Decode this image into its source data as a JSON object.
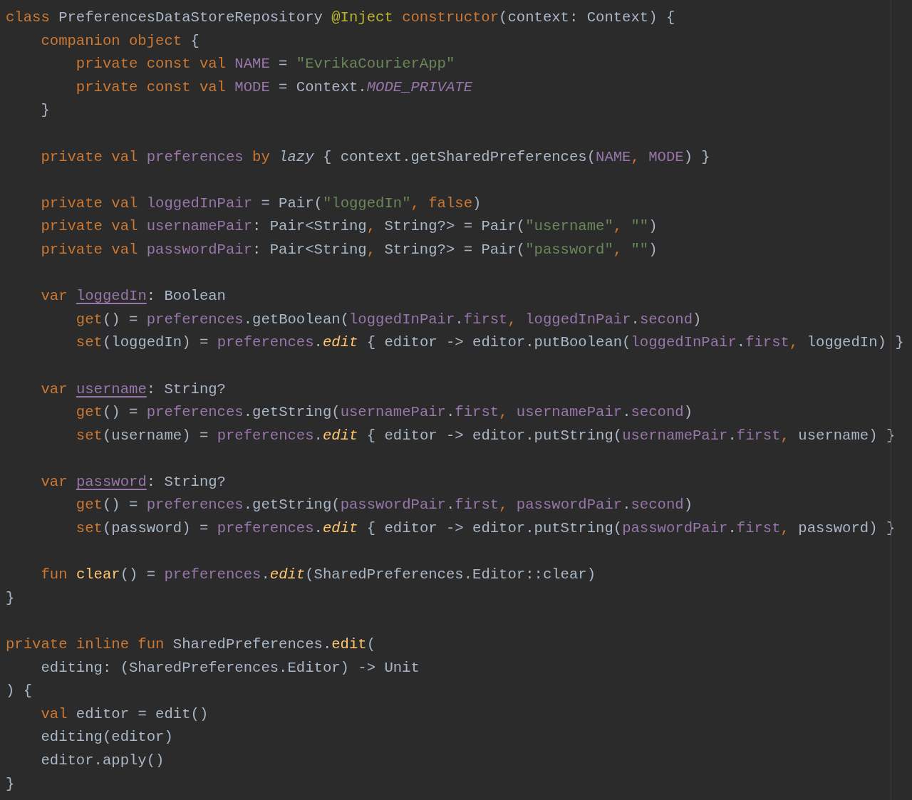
{
  "editor": {
    "lines": [
      {
        "kind": "code",
        "tokens": [
          {
            "text": "class",
            "kind": "keyword"
          },
          {
            "text": " PreferencesDataStoreRepository ",
            "kind": "plain"
          },
          {
            "text": "@Inject ",
            "kind": "annotation"
          },
          {
            "text": "constructor",
            "kind": "keyword"
          },
          {
            "text": "(context: Context) {",
            "kind": "plain"
          }
        ]
      },
      {
        "kind": "code",
        "tokens": [
          {
            "text": "    companion object",
            "kind": "keyword"
          },
          {
            "text": " {",
            "kind": "plain"
          }
        ]
      },
      {
        "kind": "code",
        "tokens": [
          {
            "text": "        private const val ",
            "kind": "keyword"
          },
          {
            "text": "NAME",
            "kind": "property"
          },
          {
            "text": " = ",
            "kind": "plain"
          },
          {
            "text": "\"EvrikaCourierApp\"",
            "kind": "string"
          }
        ]
      },
      {
        "kind": "code",
        "tokens": [
          {
            "text": "        private const val ",
            "kind": "keyword"
          },
          {
            "text": "MODE",
            "kind": "property"
          },
          {
            "text": " = Context.",
            "kind": "plain"
          },
          {
            "text": "MODE_PRIVATE",
            "kind": "property-italic"
          }
        ]
      },
      {
        "kind": "code",
        "tokens": [
          {
            "text": "    }",
            "kind": "plain"
          }
        ]
      },
      {
        "kind": "blank"
      },
      {
        "kind": "code",
        "tokens": [
          {
            "text": "    private val ",
            "kind": "keyword"
          },
          {
            "text": "preferences ",
            "kind": "property"
          },
          {
            "text": "by ",
            "kind": "keyword"
          },
          {
            "text": "lazy",
            "kind": "plain-italic"
          },
          {
            "text": " { context.getSharedPreferences(",
            "kind": "plain"
          },
          {
            "text": "NAME",
            "kind": "property"
          },
          {
            "text": ", ",
            "kind": "keyword"
          },
          {
            "text": "MODE",
            "kind": "property"
          },
          {
            "text": ") }",
            "kind": "plain"
          }
        ]
      },
      {
        "kind": "blank"
      },
      {
        "kind": "code",
        "tokens": [
          {
            "text": "    private val ",
            "kind": "keyword"
          },
          {
            "text": "loggedInPair",
            "kind": "property"
          },
          {
            "text": " = Pair(",
            "kind": "plain"
          },
          {
            "text": "\"loggedIn\"",
            "kind": "string"
          },
          {
            "text": ", ",
            "kind": "keyword"
          },
          {
            "text": "false",
            "kind": "keyword"
          },
          {
            "text": ")",
            "kind": "plain"
          }
        ]
      },
      {
        "kind": "code",
        "tokens": [
          {
            "text": "    private val ",
            "kind": "keyword"
          },
          {
            "text": "usernamePair",
            "kind": "property"
          },
          {
            "text": ": Pair<String",
            "kind": "plain"
          },
          {
            "text": ", ",
            "kind": "keyword"
          },
          {
            "text": "String?> = Pair(",
            "kind": "plain"
          },
          {
            "text": "\"username\"",
            "kind": "string"
          },
          {
            "text": ", ",
            "kind": "keyword"
          },
          {
            "text": "\"\"",
            "kind": "string"
          },
          {
            "text": ")",
            "kind": "plain"
          }
        ]
      },
      {
        "kind": "code",
        "tokens": [
          {
            "text": "    private val ",
            "kind": "keyword"
          },
          {
            "text": "passwordPair",
            "kind": "property"
          },
          {
            "text": ": Pair<String",
            "kind": "plain"
          },
          {
            "text": ", ",
            "kind": "keyword"
          },
          {
            "text": "String?> = Pair(",
            "kind": "plain"
          },
          {
            "text": "\"password\"",
            "kind": "string"
          },
          {
            "text": ", ",
            "kind": "keyword"
          },
          {
            "text": "\"\"",
            "kind": "string"
          },
          {
            "text": ")",
            "kind": "plain"
          }
        ]
      },
      {
        "kind": "blank"
      },
      {
        "kind": "code",
        "tokens": [
          {
            "text": "    var ",
            "kind": "keyword"
          },
          {
            "text": "loggedIn",
            "kind": "property-underline"
          },
          {
            "text": ": Boolean",
            "kind": "plain"
          }
        ]
      },
      {
        "kind": "code",
        "tokens": [
          {
            "text": "        get",
            "kind": "keyword"
          },
          {
            "text": "() = ",
            "kind": "plain"
          },
          {
            "text": "preferences",
            "kind": "property"
          },
          {
            "text": ".getBoolean(",
            "kind": "plain"
          },
          {
            "text": "loggedInPair",
            "kind": "property"
          },
          {
            "text": ".",
            "kind": "plain"
          },
          {
            "text": "first",
            "kind": "property"
          },
          {
            "text": ", ",
            "kind": "keyword"
          },
          {
            "text": "loggedInPair",
            "kind": "property"
          },
          {
            "text": ".",
            "kind": "plain"
          },
          {
            "text": "second",
            "kind": "property"
          },
          {
            "text": ")",
            "kind": "plain"
          }
        ]
      },
      {
        "kind": "code",
        "tokens": [
          {
            "text": "        set",
            "kind": "keyword"
          },
          {
            "text": "(loggedIn) = ",
            "kind": "plain"
          },
          {
            "text": "preferences",
            "kind": "property"
          },
          {
            "text": ".",
            "kind": "plain"
          },
          {
            "text": "edit",
            "kind": "function-italic"
          },
          {
            "text": " { editor -> editor.putBoolean(",
            "kind": "plain"
          },
          {
            "text": "loggedInPair",
            "kind": "property"
          },
          {
            "text": ".",
            "kind": "plain"
          },
          {
            "text": "first",
            "kind": "property"
          },
          {
            "text": ", ",
            "kind": "keyword"
          },
          {
            "text": "loggedIn) }",
            "kind": "plain"
          }
        ]
      },
      {
        "kind": "blank"
      },
      {
        "kind": "code",
        "tokens": [
          {
            "text": "    var ",
            "kind": "keyword"
          },
          {
            "text": "username",
            "kind": "property-underline"
          },
          {
            "text": ": String?",
            "kind": "plain"
          }
        ]
      },
      {
        "kind": "code",
        "tokens": [
          {
            "text": "        get",
            "kind": "keyword"
          },
          {
            "text": "() = ",
            "kind": "plain"
          },
          {
            "text": "preferences",
            "kind": "property"
          },
          {
            "text": ".getString(",
            "kind": "plain"
          },
          {
            "text": "usernamePair",
            "kind": "property"
          },
          {
            "text": ".",
            "kind": "plain"
          },
          {
            "text": "first",
            "kind": "property"
          },
          {
            "text": ", ",
            "kind": "keyword"
          },
          {
            "text": "usernamePair",
            "kind": "property"
          },
          {
            "text": ".",
            "kind": "plain"
          },
          {
            "text": "second",
            "kind": "property"
          },
          {
            "text": ")",
            "kind": "plain"
          }
        ]
      },
      {
        "kind": "code",
        "tokens": [
          {
            "text": "        set",
            "kind": "keyword"
          },
          {
            "text": "(username) = ",
            "kind": "plain"
          },
          {
            "text": "preferences",
            "kind": "property"
          },
          {
            "text": ".",
            "kind": "plain"
          },
          {
            "text": "edit",
            "kind": "function-italic"
          },
          {
            "text": " { editor -> editor.putString(",
            "kind": "plain"
          },
          {
            "text": "usernamePair",
            "kind": "property"
          },
          {
            "text": ".",
            "kind": "plain"
          },
          {
            "text": "first",
            "kind": "property"
          },
          {
            "text": ", ",
            "kind": "keyword"
          },
          {
            "text": "username) }",
            "kind": "plain"
          }
        ]
      },
      {
        "kind": "blank"
      },
      {
        "kind": "code",
        "tokens": [
          {
            "text": "    var ",
            "kind": "keyword"
          },
          {
            "text": "password",
            "kind": "property-underline"
          },
          {
            "text": ": String?",
            "kind": "plain"
          }
        ]
      },
      {
        "kind": "code",
        "tokens": [
          {
            "text": "        get",
            "kind": "keyword"
          },
          {
            "text": "() = ",
            "kind": "plain"
          },
          {
            "text": "preferences",
            "kind": "property"
          },
          {
            "text": ".getString(",
            "kind": "plain"
          },
          {
            "text": "passwordPair",
            "kind": "property"
          },
          {
            "text": ".",
            "kind": "plain"
          },
          {
            "text": "first",
            "kind": "property"
          },
          {
            "text": ", ",
            "kind": "keyword"
          },
          {
            "text": "passwordPair",
            "kind": "property"
          },
          {
            "text": ".",
            "kind": "plain"
          },
          {
            "text": "second",
            "kind": "property"
          },
          {
            "text": ")",
            "kind": "plain"
          }
        ]
      },
      {
        "kind": "code",
        "tokens": [
          {
            "text": "        set",
            "kind": "keyword"
          },
          {
            "text": "(password) = ",
            "kind": "plain"
          },
          {
            "text": "preferences",
            "kind": "property"
          },
          {
            "text": ".",
            "kind": "plain"
          },
          {
            "text": "edit",
            "kind": "function-italic"
          },
          {
            "text": " { editor -> editor.putString(",
            "kind": "plain"
          },
          {
            "text": "passwordPair",
            "kind": "property"
          },
          {
            "text": ".",
            "kind": "plain"
          },
          {
            "text": "first",
            "kind": "property"
          },
          {
            "text": ", ",
            "kind": "keyword"
          },
          {
            "text": "password) }",
            "kind": "plain"
          }
        ]
      },
      {
        "kind": "blank"
      },
      {
        "kind": "code",
        "tokens": [
          {
            "text": "    fun ",
            "kind": "keyword"
          },
          {
            "text": "clear",
            "kind": "function"
          },
          {
            "text": "() = ",
            "kind": "plain"
          },
          {
            "text": "preferences",
            "kind": "property"
          },
          {
            "text": ".",
            "kind": "plain"
          },
          {
            "text": "edit",
            "kind": "function-italic"
          },
          {
            "text": "(SharedPreferences.Editor::clear)",
            "kind": "plain"
          }
        ]
      },
      {
        "kind": "code",
        "tokens": [
          {
            "text": "}",
            "kind": "plain"
          }
        ]
      },
      {
        "kind": "blank"
      },
      {
        "kind": "code",
        "tokens": [
          {
            "text": "private inline fun",
            "kind": "keyword"
          },
          {
            "text": " SharedPreferences.",
            "kind": "plain"
          },
          {
            "text": "edit",
            "kind": "function"
          },
          {
            "text": "(",
            "kind": "plain"
          }
        ]
      },
      {
        "kind": "code",
        "tokens": [
          {
            "text": "    editing: (SharedPreferences.Editor) -> Unit",
            "kind": "plain"
          }
        ]
      },
      {
        "kind": "code",
        "tokens": [
          {
            "text": ") {",
            "kind": "plain"
          }
        ]
      },
      {
        "kind": "code",
        "tokens": [
          {
            "text": "    val",
            "kind": "keyword"
          },
          {
            "text": " editor = edit()",
            "kind": "plain"
          }
        ]
      },
      {
        "kind": "code",
        "tokens": [
          {
            "text": "    editing(editor)",
            "kind": "plain"
          }
        ]
      },
      {
        "kind": "code",
        "tokens": [
          {
            "text": "    editor.apply()",
            "kind": "plain"
          }
        ]
      },
      {
        "kind": "code",
        "tokens": [
          {
            "text": "}",
            "kind": "plain"
          }
        ]
      }
    ]
  }
}
